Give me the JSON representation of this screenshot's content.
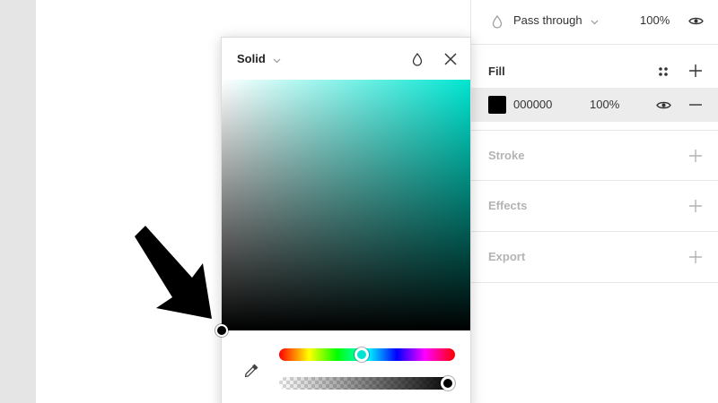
{
  "layer": {
    "blend_mode": "Pass through",
    "opacity": "100%"
  },
  "fill": {
    "title": "Fill",
    "hex": "000000",
    "opacity": "100%",
    "swatch_color": "#000000"
  },
  "sections": {
    "stroke": "Stroke",
    "effects": "Effects",
    "export": "Export"
  },
  "picker": {
    "mode": "Solid",
    "hue_color": "#00e5d1",
    "hue_position": 0.47,
    "alpha_position": 0.96
  },
  "icons": {
    "blend": "drop-icon",
    "visibility": "eye-icon",
    "styles": "four-dots-icon",
    "add": "plus-icon",
    "remove": "minus-icon",
    "close": "close-icon",
    "eyedropper": "eyedropper-icon",
    "annotation": "arrow-icon"
  }
}
